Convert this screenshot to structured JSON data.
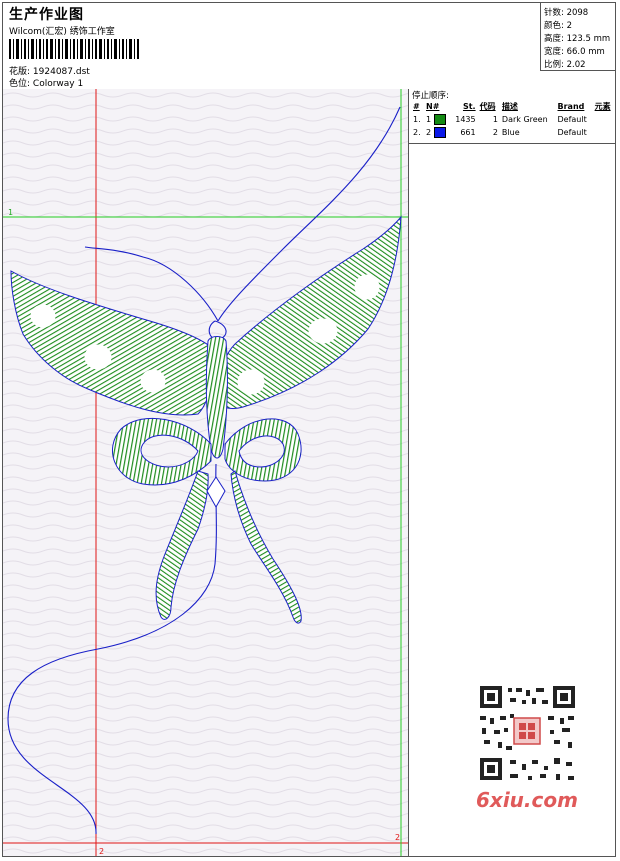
{
  "header": {
    "title": "生产作业图",
    "subtitle": "Wilcom(汇宏) 绣饰工作室",
    "design_label": "花版:",
    "design_file": "1924087.dst",
    "colorway_label": "色位:",
    "colorway": "Colorway 1"
  },
  "stats": [
    {
      "label": "针数:",
      "value": "2098"
    },
    {
      "label": "颜色:",
      "value": "2"
    },
    {
      "label": "高度:",
      "value": "123.5 mm"
    },
    {
      "label": "宽度:",
      "value": "66.0 mm"
    },
    {
      "label": "比例:",
      "value": "2.02"
    }
  ],
  "sequence": {
    "heading": "停止顺序:",
    "columns": [
      "#",
      "N#",
      "St.",
      "代码",
      "描述",
      "Brand",
      "元素"
    ],
    "rows": [
      {
        "idx": "1.",
        "n": "1",
        "st": "1435",
        "code": "1",
        "desc": "Dark Green",
        "brand": "Default",
        "color": "#138a13"
      },
      {
        "idx": "2.",
        "n": "2",
        "st": "661",
        "code": "2",
        "desc": "Blue",
        "brand": "Default",
        "color": "#0a18e8"
      }
    ]
  },
  "guides": {
    "green_top": "1",
    "red_right": "2",
    "red_bottom": "2"
  },
  "colors": {
    "green_thread": "#1e8c1e",
    "blue_thread": "#1a20c8",
    "guide_red": "#e01515",
    "guide_green": "#22cc22"
  },
  "watermark": "6xiu.com"
}
